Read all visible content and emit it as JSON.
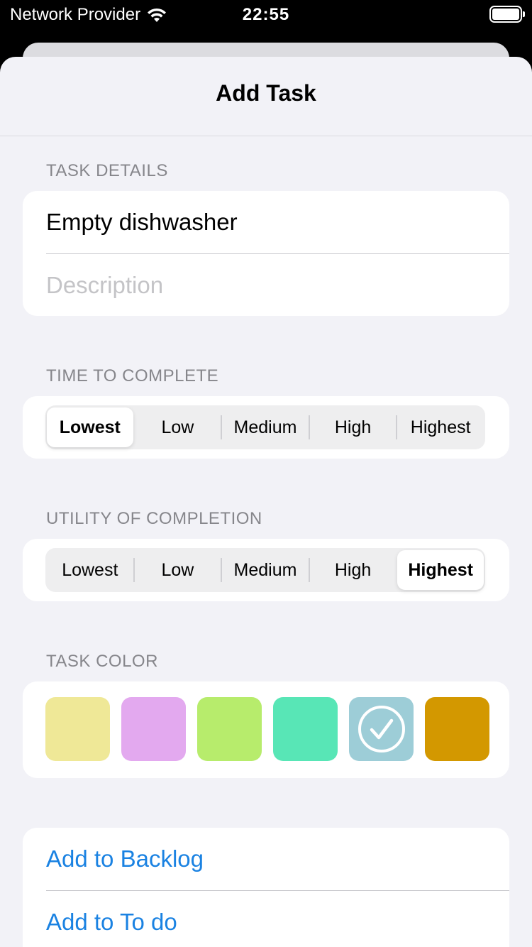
{
  "status_bar": {
    "carrier": "Network Provider",
    "time": "22:55"
  },
  "nav": {
    "title": "Add Task"
  },
  "task_details": {
    "header": "TASK DETAILS",
    "title_value": "Empty dishwasher",
    "description_placeholder": "Description"
  },
  "time_to_complete": {
    "header": "TIME TO COMPLETE",
    "options": [
      "Lowest",
      "Low",
      "Medium",
      "High",
      "Highest"
    ],
    "selected": "Lowest"
  },
  "utility_of_completion": {
    "header": "UTILITY OF COMPLETION",
    "options": [
      "Lowest",
      "Low",
      "Medium",
      "High",
      "Highest"
    ],
    "selected": "Highest"
  },
  "task_color": {
    "header": "TASK COLOR",
    "colors": [
      "#efe897",
      "#e3a9ef",
      "#b7ec6c",
      "#58e6b6",
      "#9dcdd7",
      "#d39800"
    ],
    "selected_index": 4
  },
  "actions": {
    "add_to_backlog": "Add to Backlog",
    "add_to_todo": "Add to To do"
  }
}
